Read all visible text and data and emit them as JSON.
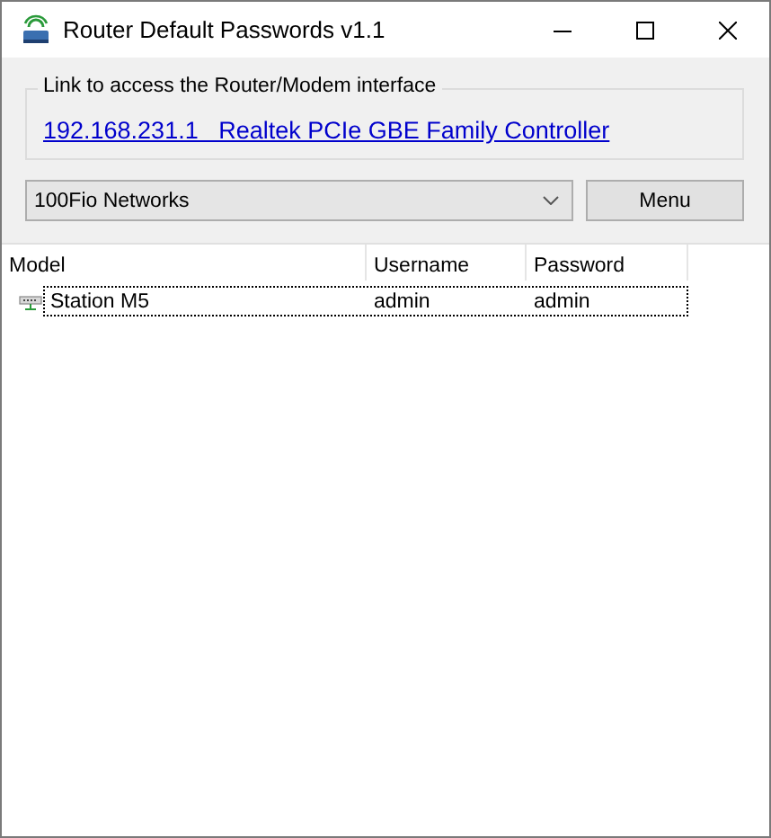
{
  "window": {
    "title": "Router Default Passwords v1.1"
  },
  "link_group": {
    "label": "Link to access the Router/Modem interface",
    "link": "192.168.231.1   Realtek PCIe GBE Family Controller"
  },
  "vendor_dropdown": {
    "value": "100Fio Networks"
  },
  "menu_button": "Menu",
  "table": {
    "columns": [
      "Model",
      "Username",
      "Password"
    ],
    "rows": [
      {
        "cells": [
          "Station M5",
          "admin",
          "admin"
        ],
        "focused": true
      }
    ]
  }
}
